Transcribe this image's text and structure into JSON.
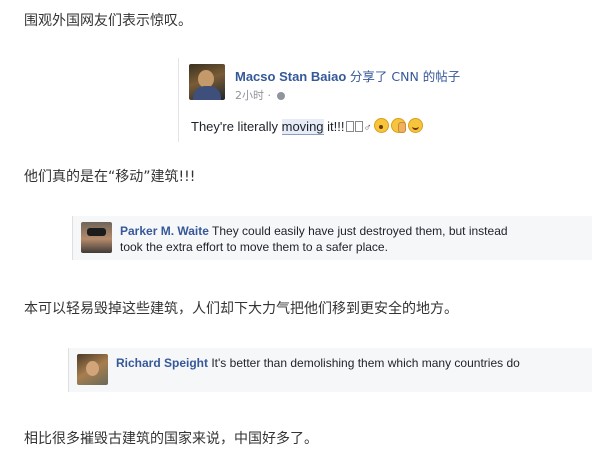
{
  "paragraphs": {
    "p1": "围观外国网友们表示惊叹。",
    "p2": "他们真的是在“移动”建筑!!!",
    "p3": "本可以轻易毁掉这些建筑，人们却下大力气把他们移到更安全的地方。",
    "p4": "相比很多摧毁古建筑的国家来说，中国好多了。"
  },
  "post": {
    "author": "Macso Stan Baiao",
    "action": "分享了 CNN 的帖子",
    "time": "2小时",
    "separator": "·",
    "icon": "globe-icon",
    "text_before": "They're literally ",
    "text_highlight": "moving",
    "text_after": " it!!!",
    "gender_symbol": "♂",
    "emojis": [
      "astonished-face-icon",
      "facepalm-icon",
      "smile-face-icon"
    ]
  },
  "comments": [
    {
      "name": "Parker M. Waite",
      "text": " They could easily have just destroyed them, but instead took the extra effort to move them to a safer place."
    },
    {
      "name": "Richard Speight",
      "text": " It's better than demolishing them which many countries do"
    }
  ],
  "colors": {
    "link_blue": "#365899",
    "comment_bg": "#f6f7f9",
    "meta_gray": "#90949c"
  }
}
